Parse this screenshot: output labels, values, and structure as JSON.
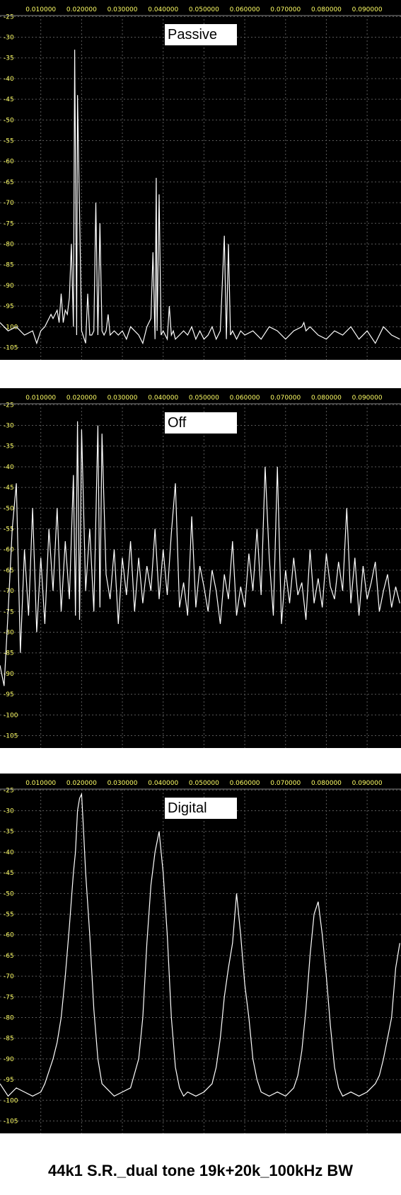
{
  "caption": "44k1 S.R._dual tone 19k+20k_100kHz BW",
  "colors": {
    "background": "#000000",
    "grid": "#5a5a5a",
    "tick_label": "#ffff66",
    "trace": "#ffffff"
  },
  "chart_data": [
    {
      "type": "line",
      "title": "Passive",
      "x_tick_labels": [
        "0.010000",
        "0.020000",
        "0.030000",
        "0.040000",
        "0.050000",
        "0.060000",
        "0.070000",
        "0.080000",
        "0.090000"
      ],
      "x_ticks": [
        0.01,
        0.02,
        0.03,
        0.04,
        0.05,
        0.06,
        0.07,
        0.08,
        0.09
      ],
      "y_tick_labels": [
        "-25",
        "-30",
        "-35",
        "-40",
        "-45",
        "-50",
        "-55",
        "-60",
        "-65",
        "-70",
        "-75",
        "-80",
        "-85",
        "-90",
        "-95",
        "-100",
        "-105"
      ],
      "xlim": [
        0.0,
        0.0983
      ],
      "ylim": [
        -108,
        -21
      ],
      "grid": true,
      "series": [
        {
          "x": [
            0.0,
            0.002,
            0.004,
            0.006,
            0.008,
            0.009,
            0.01,
            0.011,
            0.0115,
            0.0125,
            0.013,
            0.014,
            0.0145,
            0.015,
            0.0155,
            0.016,
            0.0165,
            0.017,
            0.0175,
            0.018,
            0.0183,
            0.0188,
            0.019,
            0.02,
            0.021,
            0.0215,
            0.022,
            0.0225,
            0.023,
            0.0235,
            0.024,
            0.0245,
            0.025,
            0.0255,
            0.026,
            0.0265,
            0.027,
            0.028,
            0.029,
            0.03,
            0.031,
            0.032,
            0.033,
            0.034,
            0.035,
            0.036,
            0.037,
            0.0375,
            0.038,
            0.0383,
            0.0385,
            0.039,
            0.0395,
            0.04,
            0.041,
            0.0415,
            0.042,
            0.0425,
            0.043,
            0.044,
            0.045,
            0.046,
            0.047,
            0.048,
            0.049,
            0.05,
            0.051,
            0.052,
            0.053,
            0.054,
            0.055,
            0.0555,
            0.056,
            0.0565,
            0.057,
            0.0575,
            0.058,
            0.059,
            0.06,
            0.062,
            0.064,
            0.066,
            0.068,
            0.07,
            0.072,
            0.074,
            0.0745,
            0.075,
            0.076,
            0.078,
            0.08,
            0.082,
            0.084,
            0.086,
            0.088,
            0.09,
            0.092,
            0.094,
            0.096,
            0.098
          ],
          "y": [
            -99,
            -101,
            -100,
            -102,
            -101,
            -104,
            -101,
            -100,
            -99,
            -97,
            -98,
            -96,
            -99,
            -92,
            -99,
            -96,
            -97,
            -93,
            -80,
            -100,
            -33,
            -102,
            -44,
            -101,
            -104,
            -92,
            -102,
            -102,
            -101,
            -70,
            -102,
            -75,
            -101,
            -102,
            -101,
            -97,
            -102,
            -101,
            -102,
            -101,
            -103,
            -100,
            -101,
            -102,
            -104,
            -100,
            -98,
            -82,
            -103,
            -64,
            -101,
            -68,
            -102,
            -101,
            -103,
            -95,
            -102,
            -101,
            -103,
            -102,
            -101,
            -102,
            -100,
            -103,
            -101,
            -103,
            -102,
            -100,
            -103,
            -101,
            -78,
            -103,
            -80,
            -102,
            -101,
            -102,
            -103,
            -101,
            -102,
            -101,
            -103,
            -100,
            -101,
            -103,
            -101,
            -100,
            -99,
            -101,
            -100,
            -102,
            -103,
            -101,
            -102,
            -100,
            -103,
            -101,
            -104,
            -100,
            -102,
            -103
          ]
        }
      ]
    },
    {
      "type": "line",
      "title": "Off",
      "x_tick_labels": [
        "0.010000",
        "0.020000",
        "0.030000",
        "0.040000",
        "0.050000",
        "0.060000",
        "0.070000",
        "0.080000",
        "0.090000"
      ],
      "x_ticks": [
        0.01,
        0.02,
        0.03,
        0.04,
        0.05,
        0.06,
        0.07,
        0.08,
        0.09
      ],
      "y_tick_labels": [
        "-25",
        "-30",
        "-35",
        "-40",
        "-45",
        "-50",
        "-55",
        "-60",
        "-65",
        "-70",
        "-75",
        "-80",
        "-85",
        "-90",
        "-95",
        "-100",
        "-105"
      ],
      "xlim": [
        0.0,
        0.0983
      ],
      "ylim": [
        -108,
        -21
      ],
      "grid": true,
      "series": [
        {
          "x": [
            0.0,
            0.001,
            0.002,
            0.003,
            0.004,
            0.005,
            0.006,
            0.007,
            0.008,
            0.009,
            0.01,
            0.011,
            0.012,
            0.013,
            0.014,
            0.015,
            0.016,
            0.017,
            0.018,
            0.0185,
            0.019,
            0.0195,
            0.02,
            0.021,
            0.022,
            0.023,
            0.024,
            0.0245,
            0.025,
            0.026,
            0.027,
            0.028,
            0.029,
            0.03,
            0.031,
            0.032,
            0.033,
            0.034,
            0.035,
            0.036,
            0.037,
            0.038,
            0.039,
            0.04,
            0.041,
            0.042,
            0.043,
            0.044,
            0.045,
            0.046,
            0.047,
            0.048,
            0.049,
            0.05,
            0.051,
            0.052,
            0.053,
            0.054,
            0.055,
            0.056,
            0.057,
            0.058,
            0.059,
            0.06,
            0.061,
            0.062,
            0.063,
            0.064,
            0.065,
            0.066,
            0.067,
            0.068,
            0.069,
            0.07,
            0.071,
            0.072,
            0.073,
            0.074,
            0.075,
            0.076,
            0.077,
            0.078,
            0.079,
            0.08,
            0.081,
            0.082,
            0.083,
            0.084,
            0.085,
            0.086,
            0.087,
            0.088,
            0.089,
            0.09,
            0.091,
            0.092,
            0.093,
            0.094,
            0.095,
            0.096,
            0.097,
            0.098
          ],
          "y": [
            -88,
            -93,
            -75,
            -55,
            -44,
            -85,
            -60,
            -76,
            -50,
            -80,
            -62,
            -78,
            -55,
            -70,
            -50,
            -75,
            -58,
            -72,
            -42,
            -76,
            -29,
            -77,
            -31,
            -70,
            -55,
            -75,
            -30,
            -74,
            -32,
            -66,
            -72,
            -60,
            -78,
            -62,
            -71,
            -58,
            -75,
            -62,
            -73,
            -64,
            -70,
            -55,
            -72,
            -60,
            -71,
            -56,
            -44,
            -74,
            -68,
            -76,
            -52,
            -74,
            -64,
            -69,
            -75,
            -65,
            -70,
            -78,
            -66,
            -72,
            -58,
            -76,
            -69,
            -74,
            -61,
            -70,
            -55,
            -71,
            -40,
            -62,
            -76,
            -40,
            -78,
            -65,
            -73,
            -62,
            -71,
            -68,
            -77,
            -60,
            -73,
            -67,
            -74,
            -61,
            -69,
            -72,
            -63,
            -70,
            -50,
            -73,
            -62,
            -76,
            -64,
            -72,
            -68,
            -63,
            -75,
            -70,
            -66,
            -74,
            -69,
            -73
          ]
        }
      ]
    },
    {
      "type": "line",
      "title": "Digital",
      "x_tick_labels": [
        "0.010000",
        "0.020000",
        "0.030000",
        "0.040000",
        "0.050000",
        "0.060000",
        "0.070000",
        "0.080000",
        "0.090000"
      ],
      "x_ticks": [
        0.01,
        0.02,
        0.03,
        0.04,
        0.05,
        0.06,
        0.07,
        0.08,
        0.09
      ],
      "y_tick_labels": [
        "-25",
        "-30",
        "-35",
        "-40",
        "-45",
        "-50",
        "-55",
        "-60",
        "-65",
        "-70",
        "-75",
        "-80",
        "-85",
        "-90",
        "-95",
        "-100",
        "-105"
      ],
      "xlim": [
        0.0,
        0.0983
      ],
      "ylim": [
        -108,
        -21
      ],
      "grid": true,
      "series": [
        {
          "x": [
            0.0,
            0.002,
            0.004,
            0.006,
            0.008,
            0.01,
            0.011,
            0.012,
            0.013,
            0.014,
            0.015,
            0.016,
            0.017,
            0.018,
            0.0185,
            0.019,
            0.0195,
            0.02,
            0.0205,
            0.021,
            0.022,
            0.023,
            0.024,
            0.025,
            0.026,
            0.027,
            0.028,
            0.03,
            0.032,
            0.034,
            0.035,
            0.036,
            0.037,
            0.038,
            0.039,
            0.04,
            0.041,
            0.042,
            0.043,
            0.044,
            0.045,
            0.046,
            0.048,
            0.05,
            0.052,
            0.053,
            0.054,
            0.055,
            0.056,
            0.057,
            0.058,
            0.059,
            0.06,
            0.061,
            0.062,
            0.063,
            0.064,
            0.066,
            0.068,
            0.07,
            0.072,
            0.073,
            0.074,
            0.075,
            0.076,
            0.077,
            0.078,
            0.079,
            0.08,
            0.081,
            0.082,
            0.083,
            0.084,
            0.086,
            0.088,
            0.09,
            0.092,
            0.093,
            0.094,
            0.095,
            0.096,
            0.097,
            0.098
          ],
          "y": [
            -96,
            -99,
            -97,
            -98,
            -99,
            -98,
            -96,
            -93,
            -90,
            -86,
            -80,
            -70,
            -58,
            -45,
            -40,
            -30,
            -27,
            -26,
            -35,
            -45,
            -60,
            -78,
            -90,
            -96,
            -97,
            -98,
            -99,
            -98,
            -97,
            -90,
            -80,
            -62,
            -48,
            -40,
            -35,
            -45,
            -60,
            -80,
            -92,
            -97,
            -99,
            -98,
            -99,
            -98,
            -96,
            -92,
            -85,
            -75,
            -68,
            -62,
            -50,
            -60,
            -72,
            -80,
            -90,
            -95,
            -98,
            -99,
            -98,
            -99,
            -97,
            -94,
            -88,
            -78,
            -65,
            -55,
            -52,
            -60,
            -70,
            -82,
            -92,
            -97,
            -99,
            -98,
            -99,
            -98,
            -96,
            -94,
            -90,
            -85,
            -80,
            -68,
            -62
          ]
        }
      ]
    }
  ]
}
